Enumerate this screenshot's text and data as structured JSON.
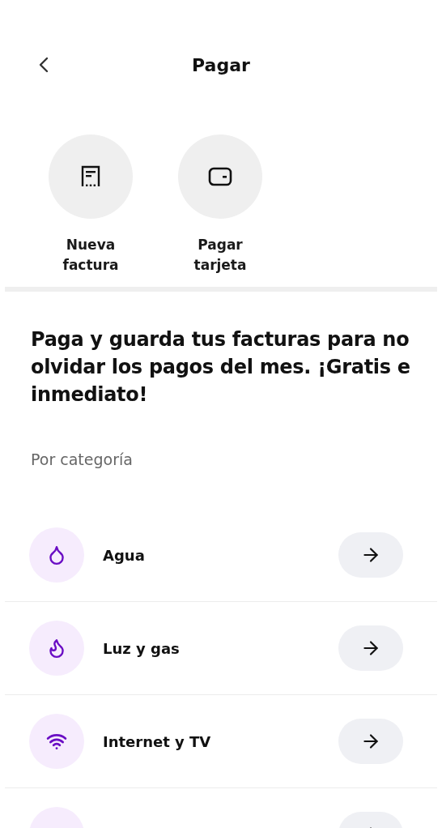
{
  "header": {
    "title": "Pagar"
  },
  "actions": [
    {
      "kind": "invoice",
      "label": "Nueva\nfactura"
    },
    {
      "kind": "card",
      "label": "Pagar\ntarjeta"
    }
  ],
  "headline": "Paga y guarda tus facturas para no olvidar los pagos del mes. ¡Gratis e inmediato!",
  "section_label": "Por categoría",
  "categories": [
    {
      "kind": "water",
      "label": "Agua"
    },
    {
      "kind": "flame",
      "label": "Luz y gas"
    },
    {
      "kind": "wifi",
      "label": "Internet y TV"
    },
    {
      "kind": "hidden"
    }
  ]
}
